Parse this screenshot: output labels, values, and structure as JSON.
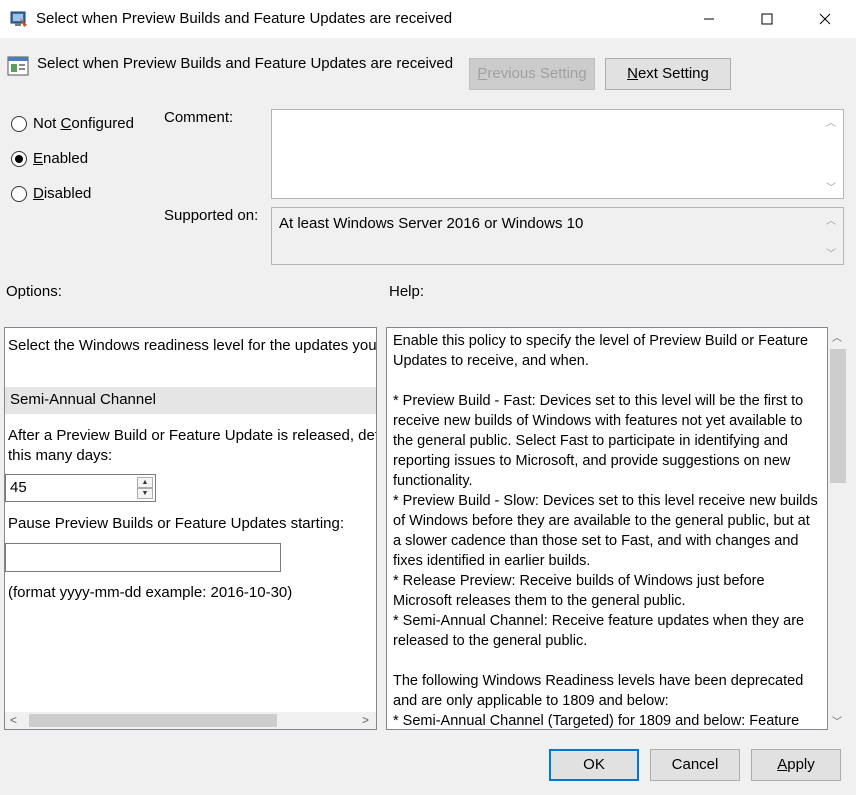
{
  "window": {
    "title": "Select when Preview Builds and Feature Updates are received",
    "minimize": "—",
    "maximize": "☐",
    "close": "✕"
  },
  "header": {
    "title": "Select when Preview Builds and Feature Updates are received"
  },
  "nav": {
    "prev_label_u": "P",
    "prev_label_rest": "revious Setting",
    "next_label_u": "N",
    "next_label_rest": "ext Setting"
  },
  "state": {
    "not_configured_pre": "Not ",
    "not_configured_u": "C",
    "not_configured_post": "onfigured",
    "enabled_u": "E",
    "enabled_post": "nabled",
    "disabled_u": "D",
    "disabled_post": "isabled",
    "selected": "Enabled"
  },
  "comment": {
    "label": "Comment:",
    "value": ""
  },
  "supported": {
    "label": "Supported on:",
    "value": "At least Windows Server 2016 or Windows 10"
  },
  "options": {
    "label": "Options:",
    "readiness_label": "Select the Windows readiness level for the updates you want to receive:",
    "readiness_value": "Semi-Annual Channel",
    "defer_label": "After a Preview Build or Feature Update is released, defer receiving it for this many days:",
    "defer_days": "45",
    "pause_label": "Pause Preview Builds or Feature Updates starting:",
    "pause_value": "",
    "format_hint": "(format yyyy-mm-dd example: 2016-10-30)"
  },
  "help": {
    "label": "Help:",
    "paragraphs": [
      "Enable this policy to specify the level of Preview Build or Feature Updates to receive, and when.",
      "",
      "* Preview Build - Fast: Devices set to this level will be the first to receive new builds of Windows with features not yet available to the general public. Select Fast to participate in identifying and reporting issues to Microsoft, and provide suggestions on new functionality.",
      "* Preview Build - Slow: Devices set to this level receive new builds of Windows before they are available to the general public, but at a slower cadence than those set to Fast, and with changes and fixes identified in earlier builds.",
      "* Release Preview: Receive builds of Windows just before Microsoft releases them to the general public.",
      "* Semi-Annual Channel: Receive feature updates when they are released to the general public.",
      "",
      "The following Windows Readiness levels have been deprecated and are only applicable to 1809 and below:",
      "* Semi-Annual Channel (Targeted) for 1809 and below: Feature"
    ]
  },
  "footer": {
    "ok": "OK",
    "cancel": "Cancel",
    "apply_u": "A",
    "apply_rest": "pply"
  }
}
